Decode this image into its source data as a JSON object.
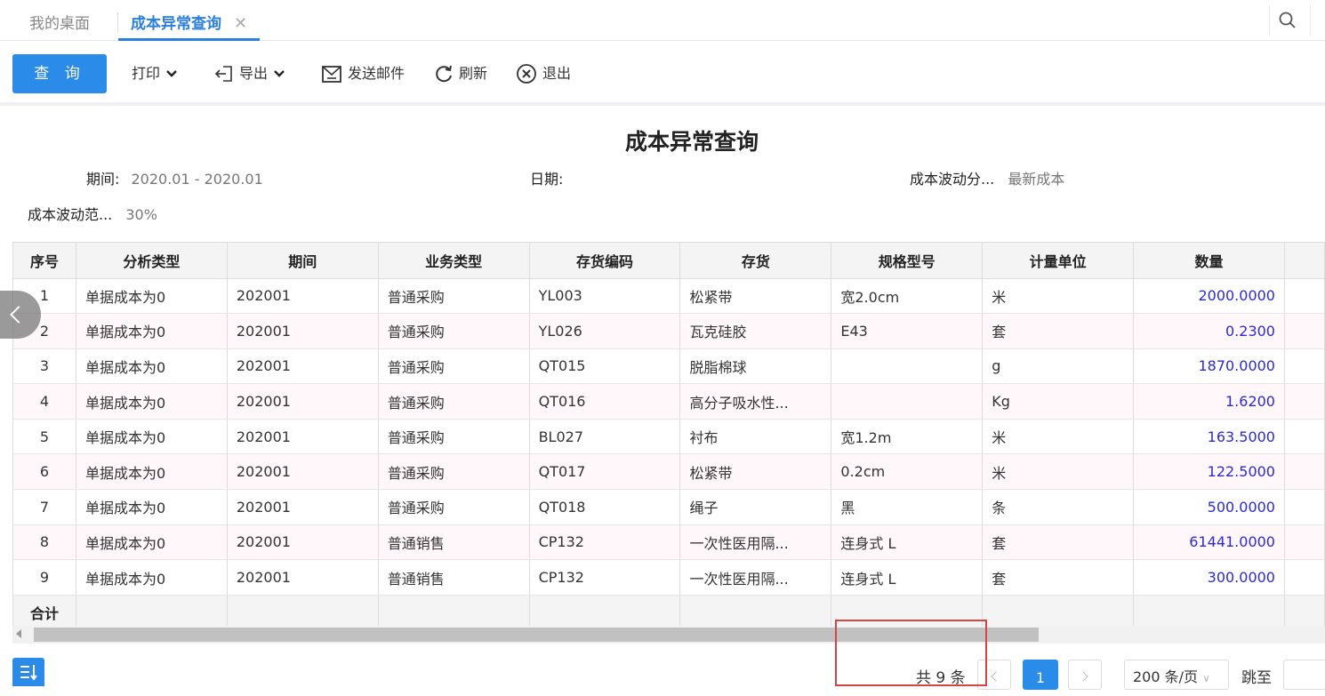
{
  "tabs": {
    "home": "我的桌面",
    "active": "成本异常查询",
    "close": "✕"
  },
  "toolbar": {
    "query": "查 询",
    "print": "打印",
    "export": "导出",
    "email": "发送邮件",
    "refresh": "刷新",
    "exit": "退出"
  },
  "report": {
    "title": "成本异常查询",
    "period_label": "期间:",
    "period_value": "2020.01 - 2020.01",
    "date_label": "日期:",
    "date_value": "",
    "cost_analysis_label": "成本波动分...",
    "cost_analysis_value": "最新成本",
    "cost_range_label": "成本波动范...",
    "cost_range_value": "30%"
  },
  "table": {
    "headers": [
      "序号",
      "分析类型",
      "期间",
      "业务类型",
      "存货编码",
      "存货",
      "规格型号",
      "计量单位",
      "数量"
    ],
    "rows": [
      [
        "1",
        "单据成本为0",
        "202001",
        "普通采购",
        "YL003",
        "松紧带",
        "宽2.0cm",
        "米",
        "2000.0000"
      ],
      [
        "2",
        "单据成本为0",
        "202001",
        "普通采购",
        "YL026",
        "瓦克硅胶",
        "E43",
        "套",
        "0.2300"
      ],
      [
        "3",
        "单据成本为0",
        "202001",
        "普通采购",
        "QT015",
        "脱脂棉球",
        "",
        "g",
        "1870.0000"
      ],
      [
        "4",
        "单据成本为0",
        "202001",
        "普通采购",
        "QT016",
        "高分子吸水性...",
        "",
        "Kg",
        "1.6200"
      ],
      [
        "5",
        "单据成本为0",
        "202001",
        "普通采购",
        "BL027",
        "衬布",
        "宽1.2m",
        "米",
        "163.5000"
      ],
      [
        "6",
        "单据成本为0",
        "202001",
        "普通采购",
        "QT017",
        "松紧带",
        "0.2cm",
        "米",
        "122.5000"
      ],
      [
        "7",
        "单据成本为0",
        "202001",
        "普通采购",
        "QT018",
        "绳子",
        "黑",
        "条",
        "500.0000"
      ],
      [
        "8",
        "单据成本为0",
        "202001",
        "普通销售",
        "CP132",
        "一次性医用隔...",
        "连身式 L",
        "套",
        "61441.0000"
      ],
      [
        "9",
        "单据成本为0",
        "202001",
        "普通销售",
        "CP132",
        "一次性医用隔...",
        "连身式 L",
        "套",
        "300.0000"
      ]
    ],
    "total_label": "合计"
  },
  "pager": {
    "total": "共 9 条",
    "prev": "<",
    "current": "1",
    "next": ">",
    "page_size": "200 条/页",
    "jump_label": "跳至"
  },
  "colors": {
    "accent": "#2a8be8",
    "number": "#2b2bd6",
    "highlight_box": "#d64545"
  }
}
